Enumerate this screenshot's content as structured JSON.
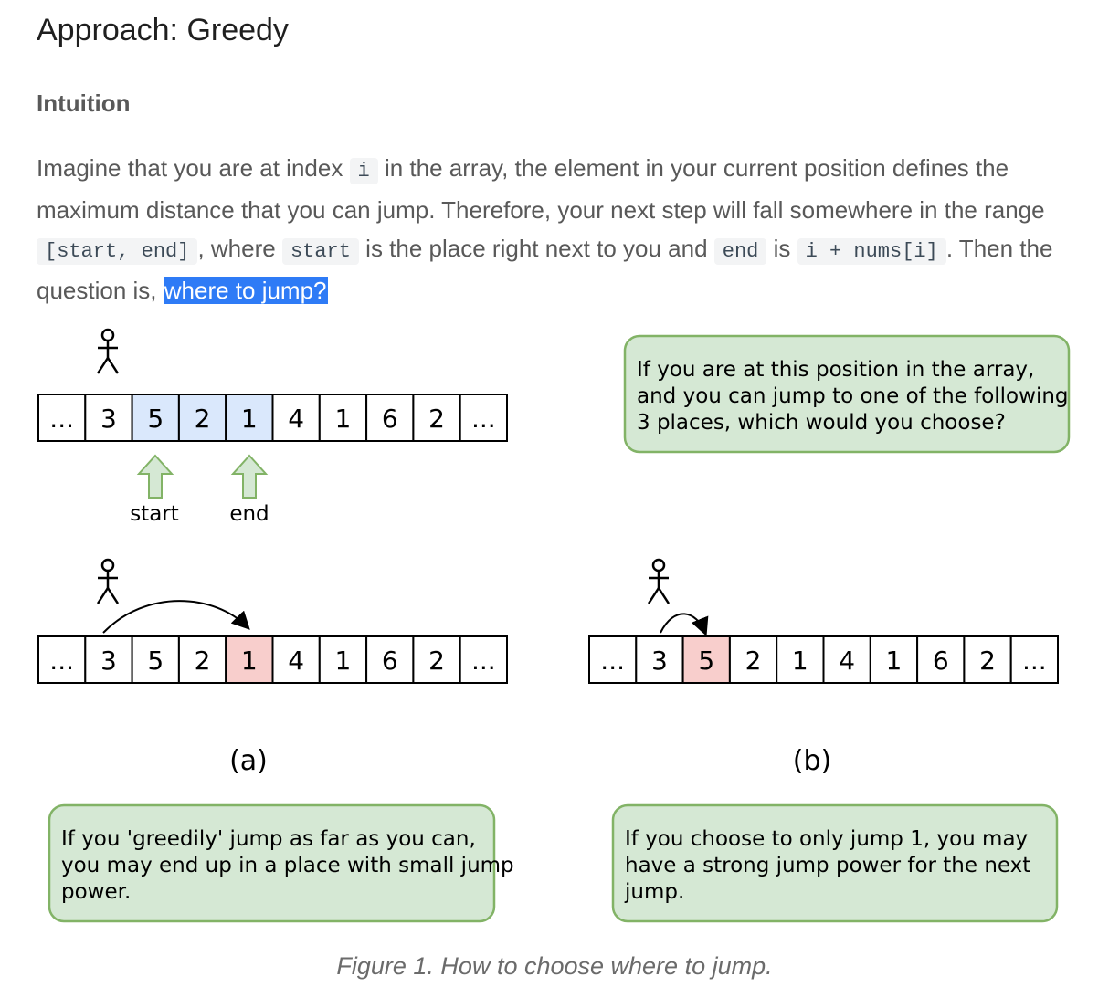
{
  "heading": "Approach: Greedy",
  "subheading": "Intuition",
  "paragraph": {
    "t1": "Imagine that you are at index ",
    "c1": "i",
    "t2": " in the array, the element in your current position defines the maximum distance that you can jump. Therefore, your next step will fall somewhere in the range ",
    "c2": "[start, end]",
    "t3": ", where ",
    "c3": "start",
    "t4": " is the place right next to you and ",
    "c4": "end",
    "t5": " is ",
    "c5": "i + nums[i]",
    "t6": ". Then the question is, ",
    "highlight": "where to jump?"
  },
  "figure": {
    "array_top": [
      "...",
      "3",
      "5",
      "2",
      "1",
      "4",
      "1",
      "6",
      "2",
      "..."
    ],
    "array_a": [
      "...",
      "3",
      "5",
      "2",
      "1",
      "4",
      "1",
      "6",
      "2",
      "..."
    ],
    "array_b": [
      "...",
      "3",
      "5",
      "2",
      "1",
      "4",
      "1",
      "6",
      "2",
      "..."
    ],
    "label_start": "start",
    "label_end": "end",
    "label_a": "(a)",
    "label_b": "(b)",
    "note_top": [
      "If you are at this position in the array,",
      "and you can jump to one of the following",
      "3 places, which would you choose?"
    ],
    "note_a": [
      "If you 'greedily' jump as far as you can,",
      "you may end up in a place with small jump",
      "power."
    ],
    "note_b": [
      "If you choose to only jump 1, you may",
      "have a strong jump power for the next",
      "jump."
    ],
    "colors": {
      "range_fill": "#dae8fc",
      "target_fill": "#f8cecc",
      "note_fill": "#d5e8d4",
      "note_stroke": "#82b366",
      "arrow_fill": "#d5e8d4"
    }
  },
  "caption": "Figure 1. How to choose where to jump."
}
